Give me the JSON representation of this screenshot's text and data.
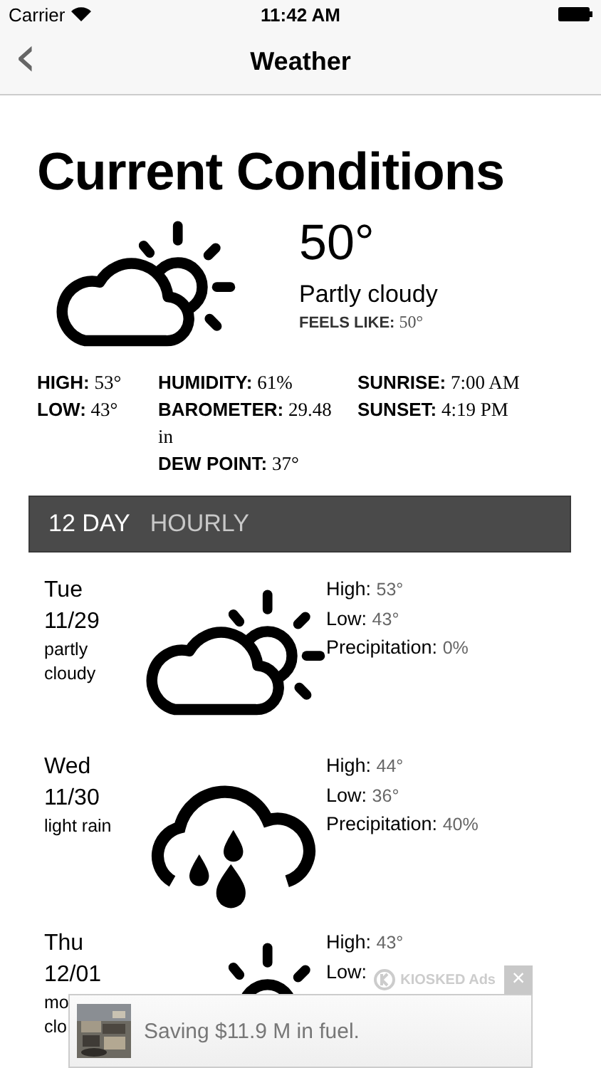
{
  "status_bar": {
    "carrier": "Carrier",
    "time": "11:42 AM"
  },
  "nav_bar": {
    "back": "‹",
    "title": "Weather"
  },
  "current": {
    "title": "Current Conditions",
    "kind": "partly-cloudy",
    "temperature": "50°",
    "condition": "Partly cloudy",
    "feels_like": {
      "label": "FEELS LIKE:",
      "value": "50°"
    },
    "details": [
      [
        {
          "text": "**HIGH:** 53°"
        },
        {
          "text": "**LOW:** 43°"
        }
      ],
      [
        {
          "text": "**HUMIDITY:** 61%"
        },
        {
          "text": "**BAROMETER:** 29.48 in"
        },
        {
          "text": "**DEW POINT:** 37°"
        }
      ],
      [
        {
          "text": "**SUNRISE:** 7:00 AM"
        },
        {
          "text": "**SUNSET:** 4:19 PM"
        }
      ]
    ]
  },
  "tabs": [
    {
      "label": "12 DAY",
      "selected": true
    },
    {
      "label": "HOURLY",
      "selected": false
    }
  ],
  "forecast": [
    {
      "day": "Tue",
      "date": "11/29",
      "description": [
        "partly",
        "cloudy"
      ],
      "kind": "partly-cloudy",
      "stats": [
        {
          "label": "High:",
          "value": "53°"
        },
        {
          "label": "Low:",
          "value": "43°"
        },
        {
          "label": "Precipitation:",
          "value": "0%"
        }
      ]
    },
    {
      "day": "Wed",
      "date": "11/30",
      "description": [
        "light rain"
      ],
      "kind": "rain",
      "stats": [
        {
          "label": "High:",
          "value": "44°"
        },
        {
          "label": "Low:",
          "value": "36°"
        },
        {
          "label": "Precipitation:",
          "value": "40%"
        }
      ]
    },
    {
      "day": "Thu",
      "date": "12/01",
      "description": [
        "mo",
        "clo"
      ],
      "kind": "sun-behind-cloud",
      "stats": [
        {
          "label": "High:",
          "value": "43°"
        },
        {
          "label": "Low:"
        }
      ]
    }
  ],
  "ad": {
    "label": "KIOSKED Ads",
    "close": "×",
    "text": "Saving $11.9 M in fuel."
  }
}
